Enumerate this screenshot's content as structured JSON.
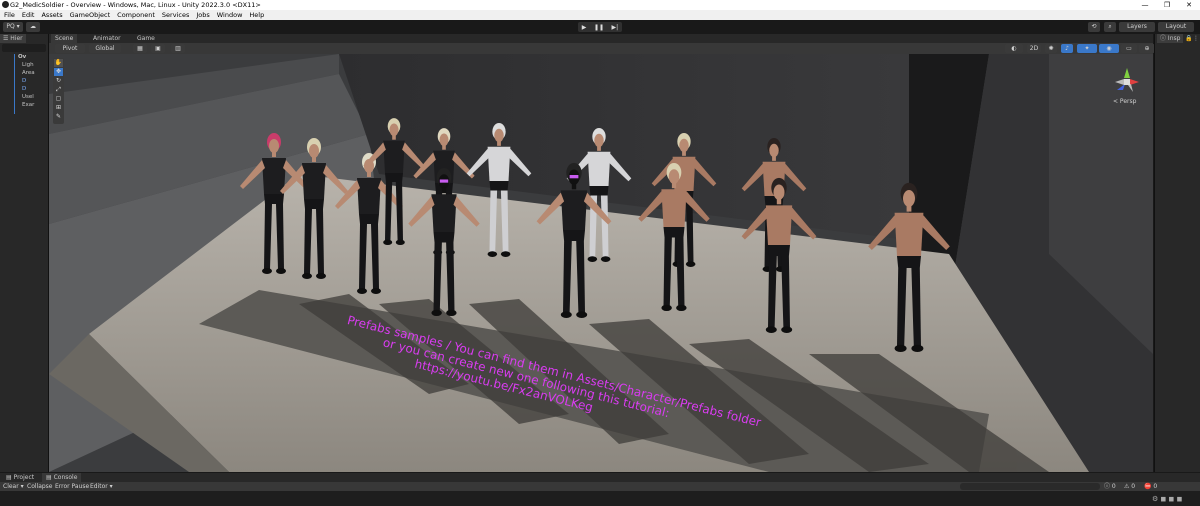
{
  "window": {
    "title": "G2_MedicSoldier - Overview - Windows, Mac, Linux - Unity 2022.3.0 <DX11>",
    "controls": [
      "—",
      "❐",
      "✕"
    ]
  },
  "menu": [
    "File",
    "Edit",
    "Assets",
    "GameObject",
    "Component",
    "Services",
    "Jobs",
    "Window",
    "Help"
  ],
  "toolbar": {
    "account_label": "PQ ▾",
    "layers_label": "Layers",
    "layout_label": "Layout"
  },
  "hierarchy": {
    "tab": "Hier",
    "items": [
      "Ov",
      "Ligh",
      "Area",
      "D",
      "D",
      "Usel",
      "Exar"
    ]
  },
  "scene": {
    "tabs": [
      "Scene",
      "Animator",
      "Game"
    ],
    "pivot_label": "Pivot",
    "global_label": "Global",
    "mode_2d": "2D",
    "persp_label": "< Persp",
    "overlay_lines": [
      "Prefabs samples / You can find them in Assets/Character/Prefabs folder",
      "or you can create new one following this tutorial:",
      "https://youtu.be/Fx2anVOLKeg"
    ]
  },
  "inspector": {
    "tab": "Insp"
  },
  "bottom": {
    "tabs": [
      "Project",
      "Console"
    ],
    "console_buttons": [
      "Clear",
      "Collapse",
      "Error Pause",
      "Editor ▾"
    ],
    "counts": [
      "0",
      "0",
      "0"
    ]
  },
  "colors": {
    "accent": "#3a78c9",
    "overlay_text": "#d93cf0"
  }
}
